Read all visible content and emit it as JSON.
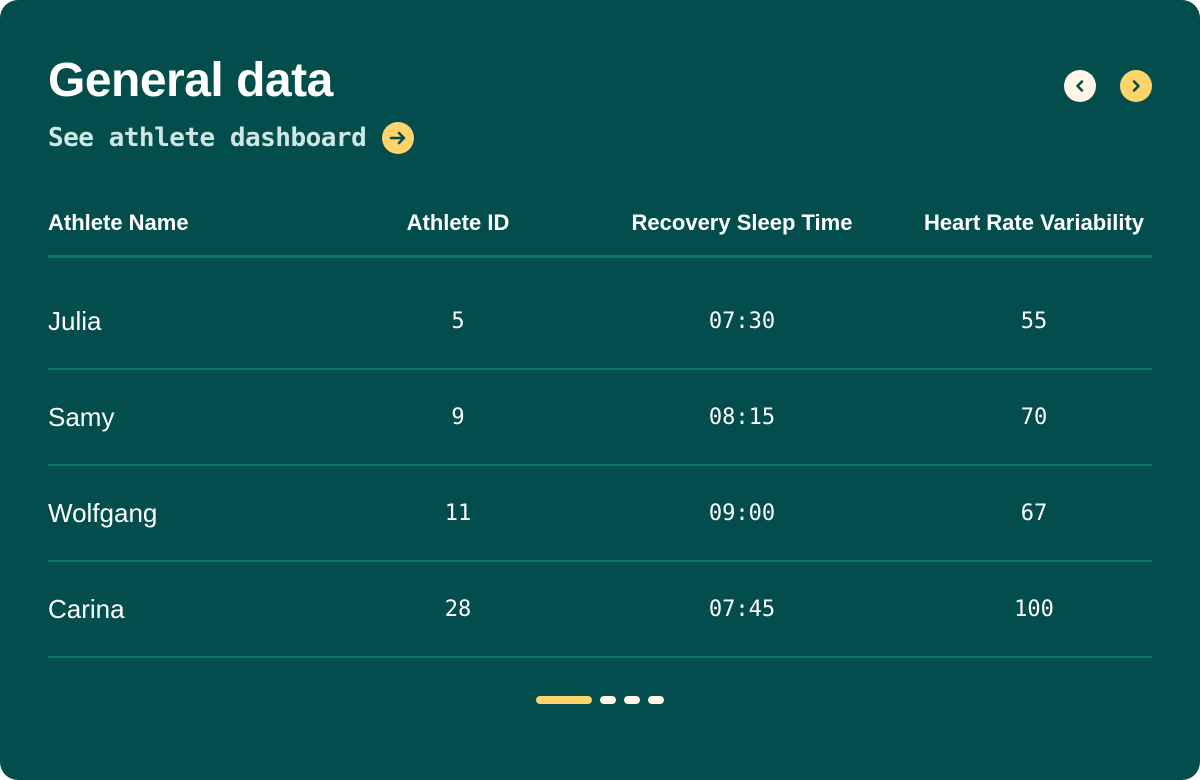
{
  "header": {
    "title": "General data",
    "link_label": "See athlete dashboard",
    "link_icon": "arrow-right-icon",
    "prev_icon": "chevron-left-icon",
    "next_icon": "chevron-right-icon"
  },
  "colors": {
    "background": "#034d4c",
    "accent": "#ffd56b",
    "divider": "#0b7773",
    "link_text": "#cfe8e4"
  },
  "table": {
    "columns": [
      "Athlete Name",
      "Athlete ID",
      "Recovery Sleep Time",
      "Heart Rate Variability"
    ],
    "rows": [
      {
        "name": "Julia",
        "id": "5",
        "sleep": "07:30",
        "hrv": "55"
      },
      {
        "name": "Samy",
        "id": "9",
        "sleep": "08:15",
        "hrv": "70"
      },
      {
        "name": "Wolfgang",
        "id": "11",
        "sleep": "09:00",
        "hrv": "67"
      },
      {
        "name": "Carina",
        "id": "28",
        "sleep": "07:45",
        "hrv": "100"
      }
    ]
  },
  "pagination": {
    "total_pages": 4,
    "current_page": 1
  }
}
